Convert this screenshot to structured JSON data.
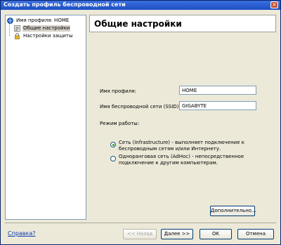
{
  "window": {
    "title": "Создать профиль беспроводной сети"
  },
  "tree": {
    "root": "Имя профиля: HOME",
    "items": [
      "Общие настройки",
      "Настройки защиты"
    ],
    "selected": "Общие настройки"
  },
  "main": {
    "header": "Общие настройки",
    "profile_name_label": "Имя профиля:",
    "profile_name_value": "HOME",
    "ssid_label": "Имя беспроводной сети (SSID):",
    "ssid_value": "GIGABYTE",
    "mode_label": "Режим работы:",
    "modes": [
      {
        "text": "Сеть (Infrastructure) - выполняет подключение к беспроводным сетям и/или Интернету.",
        "selected": true
      },
      {
        "text": "Одноранговая сеть (AdHoc) - непосредственное подключение к другим компьютерам.",
        "selected": false
      }
    ],
    "advanced_button": "Дополнительно..."
  },
  "footer": {
    "help_link": "Справка?",
    "back_button": "<< Назад",
    "next_button": "Далее >>",
    "ok_button": "OK",
    "cancel_button": "Отмена"
  }
}
